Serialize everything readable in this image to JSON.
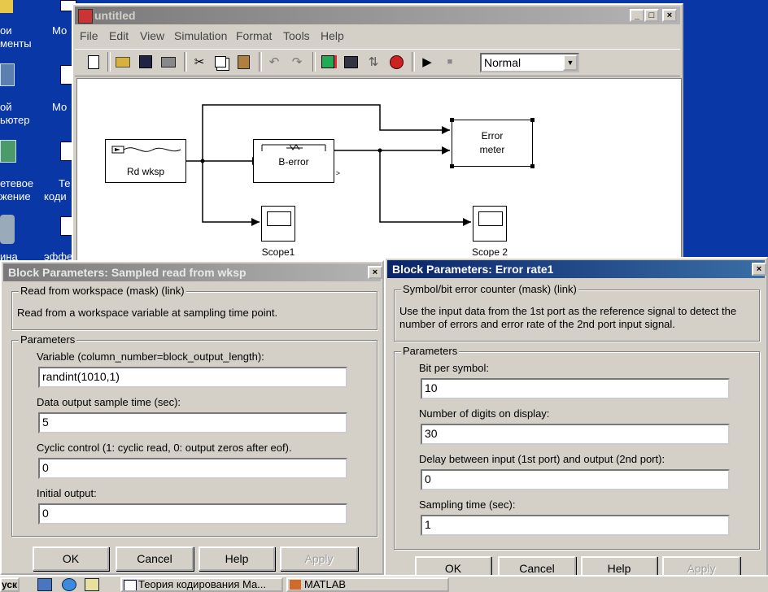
{
  "desktop": {
    "labels": [
      {
        "text": "ои"
      },
      {
        "text": "менты"
      },
      {
        "text": "ой"
      },
      {
        "text": "ьютер"
      },
      {
        "text": "етевое"
      },
      {
        "text": "жение"
      },
      {
        "text": "ина"
      },
      {
        "text": "Мо"
      },
      {
        "text": "Мо"
      },
      {
        "text": "Те"
      },
      {
        "text": "коди"
      },
      {
        "text": "эффе"
      }
    ]
  },
  "model_window": {
    "title": "untitled",
    "caption_buttons": [
      "_",
      "□",
      "×"
    ],
    "menu": [
      "File",
      "Edit",
      "View",
      "Simulation",
      "Format",
      "Tools",
      "Help"
    ],
    "sim_mode": "Normal",
    "toolbar_icons": [
      "new-icon",
      "open-icon",
      "save-icon",
      "print-icon",
      "cut-icon",
      "copy-icon",
      "paste-icon",
      "undo-icon",
      "redo-icon",
      "library-icon",
      "model-browser-icon",
      "toggle-icon",
      "debug-icon",
      "start-icon",
      "stop-icon"
    ],
    "blocks": {
      "source": "Rd wksp",
      "channel": "B-error",
      "meter": [
        "Error",
        "meter"
      ],
      "scope1": "Scope1",
      "scope2": "Scope 2"
    }
  },
  "dialog_left": {
    "title": "Block Parameters: Sampled read from wksp",
    "mask_title": "Read from workspace (mask) (link)",
    "description": "Read from a workspace variable at sampling time point.",
    "params_title": "Parameters",
    "params": [
      {
        "label": "Variable (column_number=block_output_length):",
        "value": "randint(1010,1)"
      },
      {
        "label": "Data output sample time (sec):",
        "value": "5"
      },
      {
        "label": "Cyclic control (1: cyclic read, 0: output zeros after eof).",
        "value": "0"
      },
      {
        "label": "Initial output:",
        "value": "0"
      }
    ],
    "buttons": {
      "ok": "OK",
      "cancel": "Cancel",
      "help": "Help",
      "apply": "Apply"
    }
  },
  "dialog_right": {
    "title": "Block Parameters: Error rate1",
    "mask_title": "Symbol/bit error counter (mask) (link)",
    "description_1": "Use the input data from the 1st port as the reference signal to detect the",
    "description_2": "number of errors and error rate of the 2nd port input signal.",
    "params_title": "Parameters",
    "params": [
      {
        "label": "Bit per symbol:",
        "value": "10"
      },
      {
        "label": "Number of digits on display:",
        "value": "30"
      },
      {
        "label": "Delay between input (1st port) and output (2nd port):",
        "value": "0"
      },
      {
        "label": "Sampling time (sec):",
        "value": "1"
      }
    ],
    "buttons": {
      "ok": "OK",
      "cancel": "Cancel",
      "help": "Help",
      "apply": "Apply"
    }
  },
  "taskbar": {
    "start_fragment": "уск",
    "tasks": [
      {
        "label": "Теория кодирования Ма..."
      },
      {
        "label": "MATLAB"
      }
    ]
  }
}
